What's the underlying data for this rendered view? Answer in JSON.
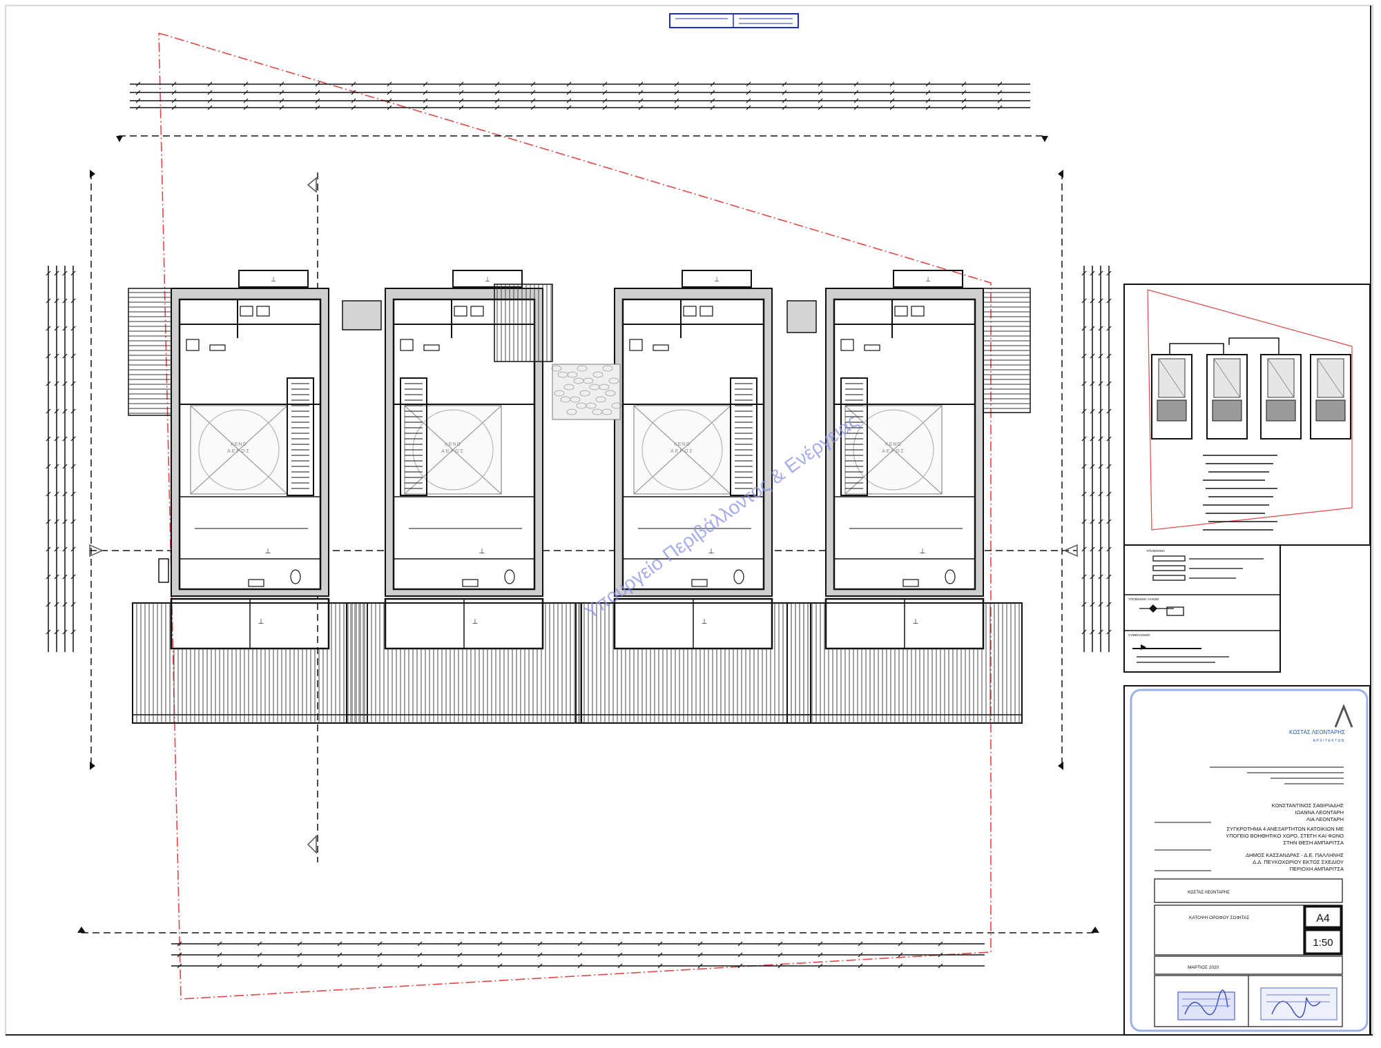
{
  "watermark": "Υπουργείο Περιβάλλοντος & Ενέργειας",
  "plan": {
    "room_label": "ΚΕΝΟ",
    "room_sublabel": "ΑΕΡΟΣ",
    "units": 4
  },
  "legend": {
    "heading": "ΥΠΟΜΝΗΜΑ",
    "sections": [
      "ΥΠΟΜΝΗΜΑ ΥΛΙΚΩΝ",
      "ΣΥΜΒΟΛΙΣΜΟΙ",
      "ΣΧΕΔΙΟ"
    ]
  },
  "title_block": {
    "office_name": "ΚΩΣΤΑΣ ΛΕΟΝΤΑΡΗΣ",
    "office_sub": "ΑΡΧΙΤΕΚΤΩΝ",
    "owners": [
      "ΚΩΝΣΤΑΝΤΙΝΟΣ ΣΑΘΙΡΙΑΔΗΣ",
      "ΙΩΑΝΝΑ ΛΕΟΝΤΑΡΗ",
      "ΛΙΑ ΛΕΟΝΤΑΡΗ"
    ],
    "project": [
      "ΣΥΓΚΡΟΤΗΜΑ 4 ΑΝΕΞΑΡΤΗΤΩΝ ΚΑΤΟΙΚΙΩΝ ΜΕ",
      "ΥΠΟΓΕΙΟ ΒΟΗΘΗΤΙΚΟ ΧΩΡΟ, ΣΤΕΓΗ ΚΑΙ ΦΩΝΟ",
      "ΣΤΗΝ ΘΕΣΗ ΑΜΠΑΡΙΤΣΑ"
    ],
    "location": [
      "ΔΗΜΟΣ ΚΑΣΣΑΝΔΡΑΣ - Δ.Ε. ΠΑΛΛΗΝΗΣ",
      "Δ.Δ. ΠΕΥΚΟΧΩΡΙΟΥ ΕΚΤΟΣ ΣΧΕΔΙΟΥ",
      "ΠΕΡΙΟΧΗ ΑΜΠΑΡΙΤΣΑ"
    ],
    "designer": "ΚΩΣΤΑΣ ΛΕΟΝΤΑΡΗΣ",
    "drawing_title": "ΚΑΤΟΨΗ ΟΡΟΦΟΥ ΣΟΦΙΤΑΣ",
    "sheet_no": "A4",
    "scale": "1:50",
    "date": "ΜΑΡΤΙΟΣ 2020"
  }
}
